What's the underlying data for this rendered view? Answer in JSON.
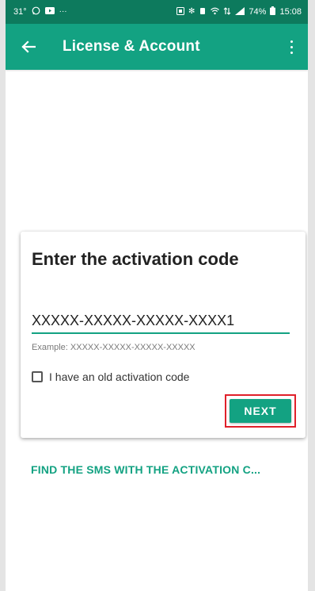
{
  "status_bar": {
    "left_text": "31°",
    "right_text": "74%",
    "time": "15:08"
  },
  "appbar": {
    "title": "License & Account",
    "back_icon": "arrow-left-icon",
    "menu_icon": "more-vertical-icon"
  },
  "card": {
    "title": "Enter the activation code",
    "input_value": "XXXXX-XXXXX-XXXXX-XXXX1",
    "example": "Example: XXXXX-XXXXX-XXXXX-XXXXX",
    "checkbox_label": "I have an old activation code",
    "checkbox_checked": false,
    "next_label": "NEXT"
  },
  "sms_link": "FIND THE SMS WITH THE ACTIVATION C..."
}
